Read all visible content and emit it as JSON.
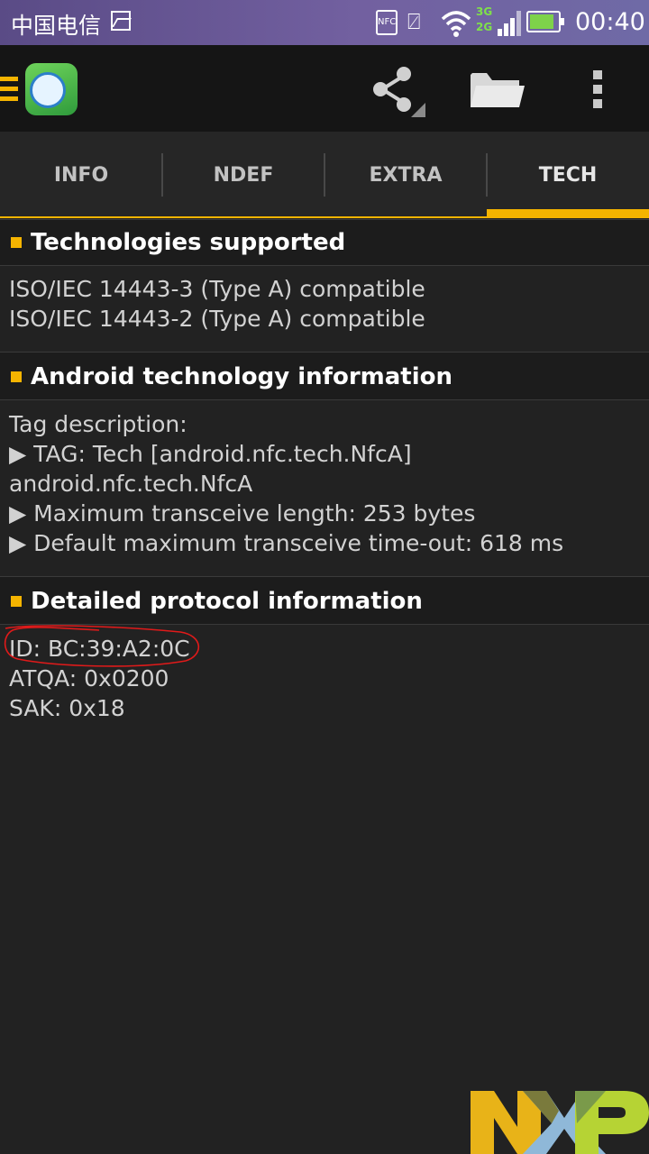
{
  "status_bar": {
    "carrier": "中国电信",
    "nfc_badge": "NFC",
    "network_3g": "3G",
    "network_2g": "2G",
    "battery_level": 0.85,
    "time": "00:40"
  },
  "action_bar": {
    "icons": [
      "menu-icon",
      "app-logo",
      "share-icon",
      "folder-icon",
      "overflow-menu-icon"
    ]
  },
  "tabs": [
    {
      "label": "INFO",
      "selected": false
    },
    {
      "label": "NDEF",
      "selected": false
    },
    {
      "label": "EXTRA",
      "selected": false
    },
    {
      "label": "TECH",
      "selected": true
    }
  ],
  "sections": [
    {
      "title": "Technologies supported",
      "lines": [
        "ISO/IEC 14443-3 (Type A) compatible",
        "ISO/IEC 14443-2 (Type A) compatible"
      ]
    },
    {
      "title": "Android technology information",
      "lines": [
        "Tag description:",
        "▶ TAG: Tech [android.nfc.tech.NfcA]",
        "android.nfc.tech.NfcA",
        "▶ Maximum transceive length: 253 bytes",
        "▶ Default maximum transceive time-out: 618 ms"
      ]
    },
    {
      "title": "Detailed protocol information",
      "lines": [
        "ID: BC:39:A2:0C",
        "ATQA: 0x0200",
        "SAK: 0x18"
      ]
    }
  ],
  "colors": {
    "accent": "#f5b400",
    "background": "#222222",
    "annotation": "#e01a1a"
  }
}
